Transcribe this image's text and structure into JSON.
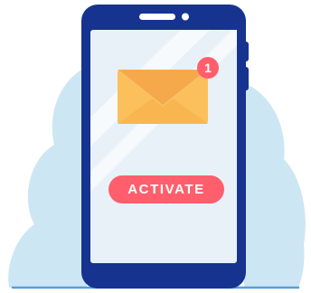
{
  "notification": {
    "badge_count": "1"
  },
  "action": {
    "activate_label": "ACTIVATE"
  },
  "colors": {
    "blob": "#cde6f4",
    "phone_body": "#16338f",
    "screen": "#e8f1f8",
    "envelope": "#fbc05c",
    "envelope_flap": "#f5a94a",
    "badge": "#ff5e6c",
    "button": "#ff5e6c",
    "ground_line": "#5a9fd4"
  },
  "icons": [
    "smartphone-icon",
    "envelope-icon",
    "notification-badge-icon"
  ]
}
